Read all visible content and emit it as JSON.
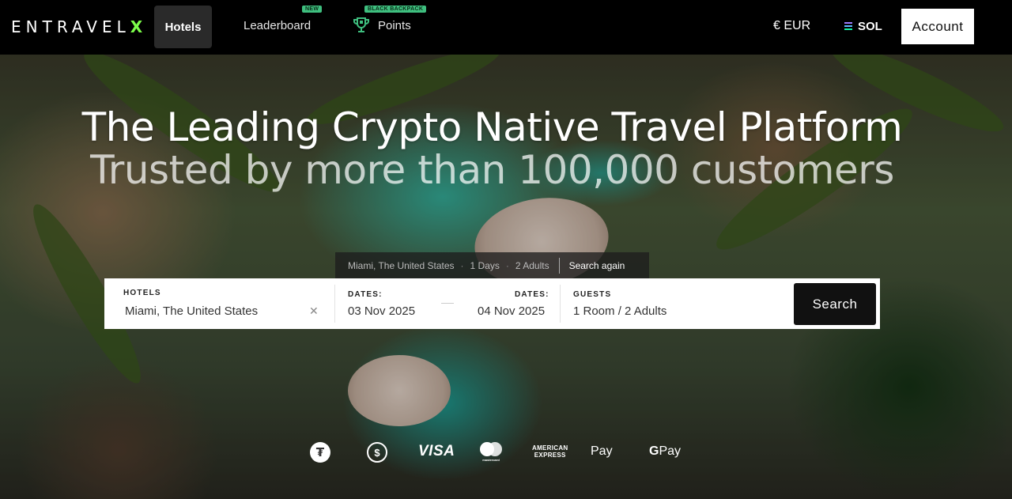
{
  "nav": {
    "logo_text": "ENTRAVEL",
    "logo_accent": "X",
    "hotels_label": "Hotels",
    "leaderboard_label": "Leaderboard",
    "leaderboard_badge": "NEW",
    "points_label": "Points",
    "points_badge": "BLACK BACKPACK",
    "currency_label": "€ EUR",
    "chain_label": "SOL",
    "account_label": "Account"
  },
  "hero": {
    "headline": "The Leading Crypto Native Travel Platform",
    "subline": "Trusted by more than 100,000 customers"
  },
  "recent_search": {
    "location": "Miami, The United States",
    "days": "1 Days",
    "adults": "2 Adults",
    "action_label": "Search again"
  },
  "search": {
    "hotels_label": "HOTELS",
    "hotels_value": "Miami, The United States",
    "checkin_label": "DATES:",
    "checkin_value": "03 Nov 2025",
    "checkout_label": "DATES:",
    "checkout_value": "04 Nov 2025",
    "guests_label": "GUESTS",
    "guests_value": "1 Room / 2 Adults",
    "button_label": "Search"
  },
  "payments": {
    "visa_text": "VISA",
    "amex_line1": "AMERICAN",
    "amex_line2": "EXPRESS",
    "applepay_text": "Pay",
    "gpay_text": "Pay",
    "mastercard_caption": "mastercard",
    "icons": [
      "tether-icon",
      "usdc-icon",
      "visa-icon",
      "mastercard-icon",
      "amex-icon",
      "apple-pay-icon",
      "google-pay-icon"
    ]
  },
  "colors": {
    "accent": "#7CFC4A",
    "badge": "#3FBF7F",
    "nav_bg": "#000000",
    "button_dark": "#111111"
  }
}
